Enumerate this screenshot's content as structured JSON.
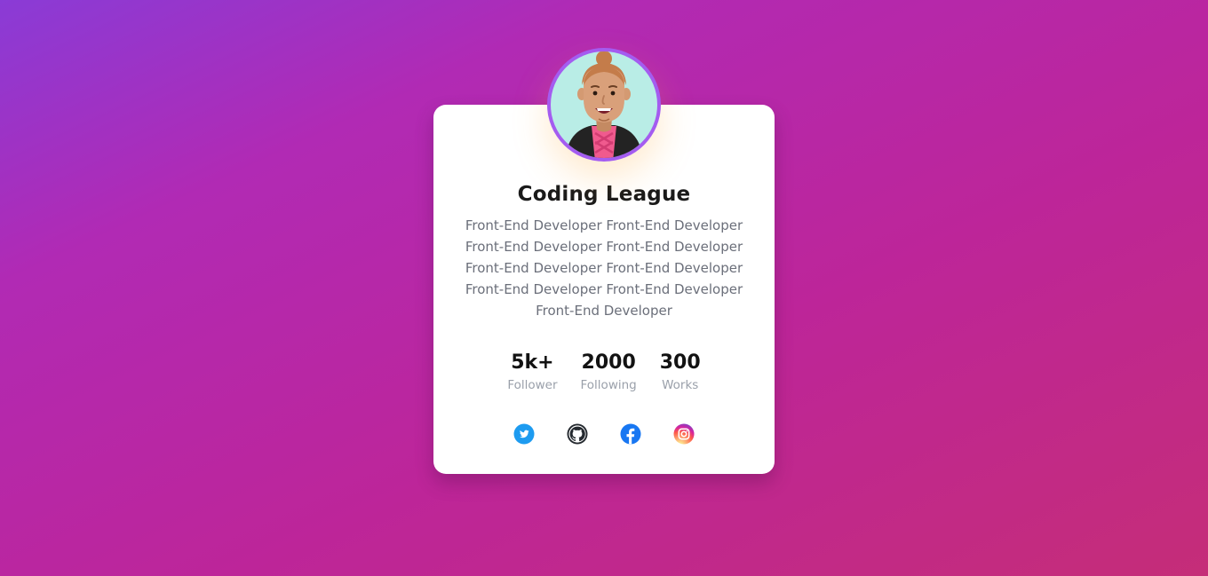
{
  "profile": {
    "name": "Coding League",
    "bio": "Front-End Developer Front-End Developer Front-End Developer Front-End Developer Front-End Developer Front-End Developer Front-End Developer Front-End Developer Front-End Developer",
    "avatar_icon": "developer-avatar"
  },
  "stats": [
    {
      "value": "5k+",
      "label": "Follower"
    },
    {
      "value": "2000",
      "label": "Following"
    },
    {
      "value": "300",
      "label": "Works"
    }
  ],
  "socials": [
    {
      "icon": "twitter-icon",
      "color": "#1d9bf0"
    },
    {
      "icon": "github-icon",
      "color": "#24292f"
    },
    {
      "icon": "facebook-icon",
      "color": "#1877f2"
    },
    {
      "icon": "instagram-icon",
      "color": "#e1306c"
    }
  ],
  "colors": {
    "background_start": "#8a3bd6",
    "background_end": "#c52d78",
    "avatar_ring": "#a45cf0",
    "avatar_bg": "#b9ede6"
  }
}
